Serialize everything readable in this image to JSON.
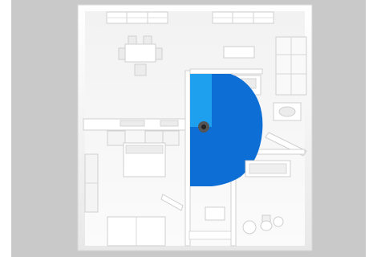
{
  "scene": {
    "kind": "isometric apartment floor plan",
    "colors": {
      "background": "#c9c9c9",
      "floor": "#f6f6f6",
      "wall": "#ffffff",
      "wall_shade": "#dcdcdc",
      "furniture": "#ececec",
      "coverage_light": "#1ea0ef",
      "coverage_dark": "#0d6fd6",
      "device": "#555555"
    },
    "icons": [
      "camera-icon"
    ]
  }
}
